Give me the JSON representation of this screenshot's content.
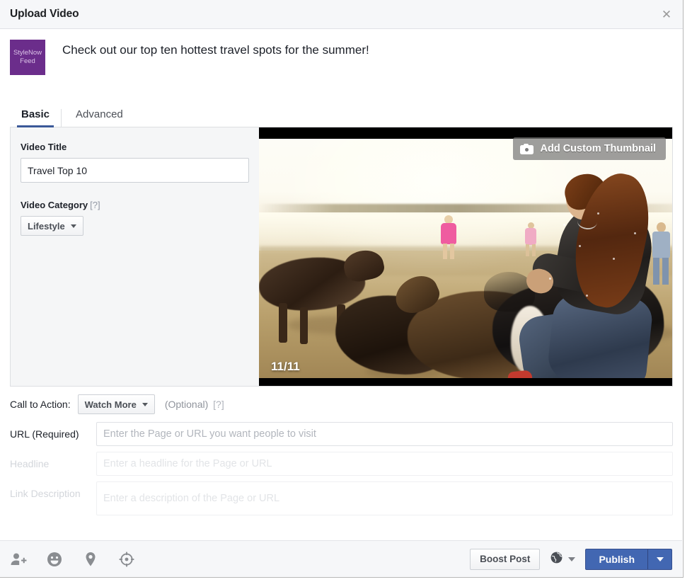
{
  "dialog": {
    "title": "Upload Video",
    "close_icon": "close-icon"
  },
  "composer": {
    "avatar_line1": "StyleNow",
    "avatar_line2": "Feed",
    "avatar_color": "#6b2d8b",
    "status_text": "Check out our top ten hottest travel spots for the summer!"
  },
  "tabs": [
    {
      "label": "Basic",
      "active": true
    },
    {
      "label": "Advanced",
      "active": false
    }
  ],
  "form": {
    "video_title_label": "Video Title",
    "video_title_value": "Travel Top 10",
    "video_category_label": "Video Category",
    "video_category_hint": "[?]",
    "video_category_value": "Lifestyle"
  },
  "video": {
    "thumbnail_button": "Add Custom Thumbnail",
    "thumbnail_icon": "camera-icon",
    "frame_counter": "11/11"
  },
  "cta": {
    "label": "Call to Action:",
    "value": "Watch More",
    "optional": "(Optional)",
    "hint": "[?]"
  },
  "link_fields": [
    {
      "label": "URL (Required)",
      "placeholder": "Enter the Page or URL you want people to visit",
      "value": "",
      "disabled": false,
      "tall": false
    },
    {
      "label": "Headline",
      "placeholder": "Enter a headline for the Page or URL",
      "value": "",
      "disabled": true,
      "tall": false
    },
    {
      "label": "Link Description",
      "placeholder": "Enter a description of the Page or URL",
      "value": "",
      "disabled": true,
      "tall": true
    }
  ],
  "footer": {
    "icons": [
      {
        "name": "tag-people-icon"
      },
      {
        "name": "emoji-icon"
      },
      {
        "name": "location-pin-icon"
      },
      {
        "name": "targeting-icon"
      }
    ],
    "boost_label": "Boost Post",
    "audience_icon": "globe-icon",
    "publish_label": "Publish",
    "publish_caret_icon": "chevron-down-icon",
    "publish_color": "#4267b2"
  }
}
